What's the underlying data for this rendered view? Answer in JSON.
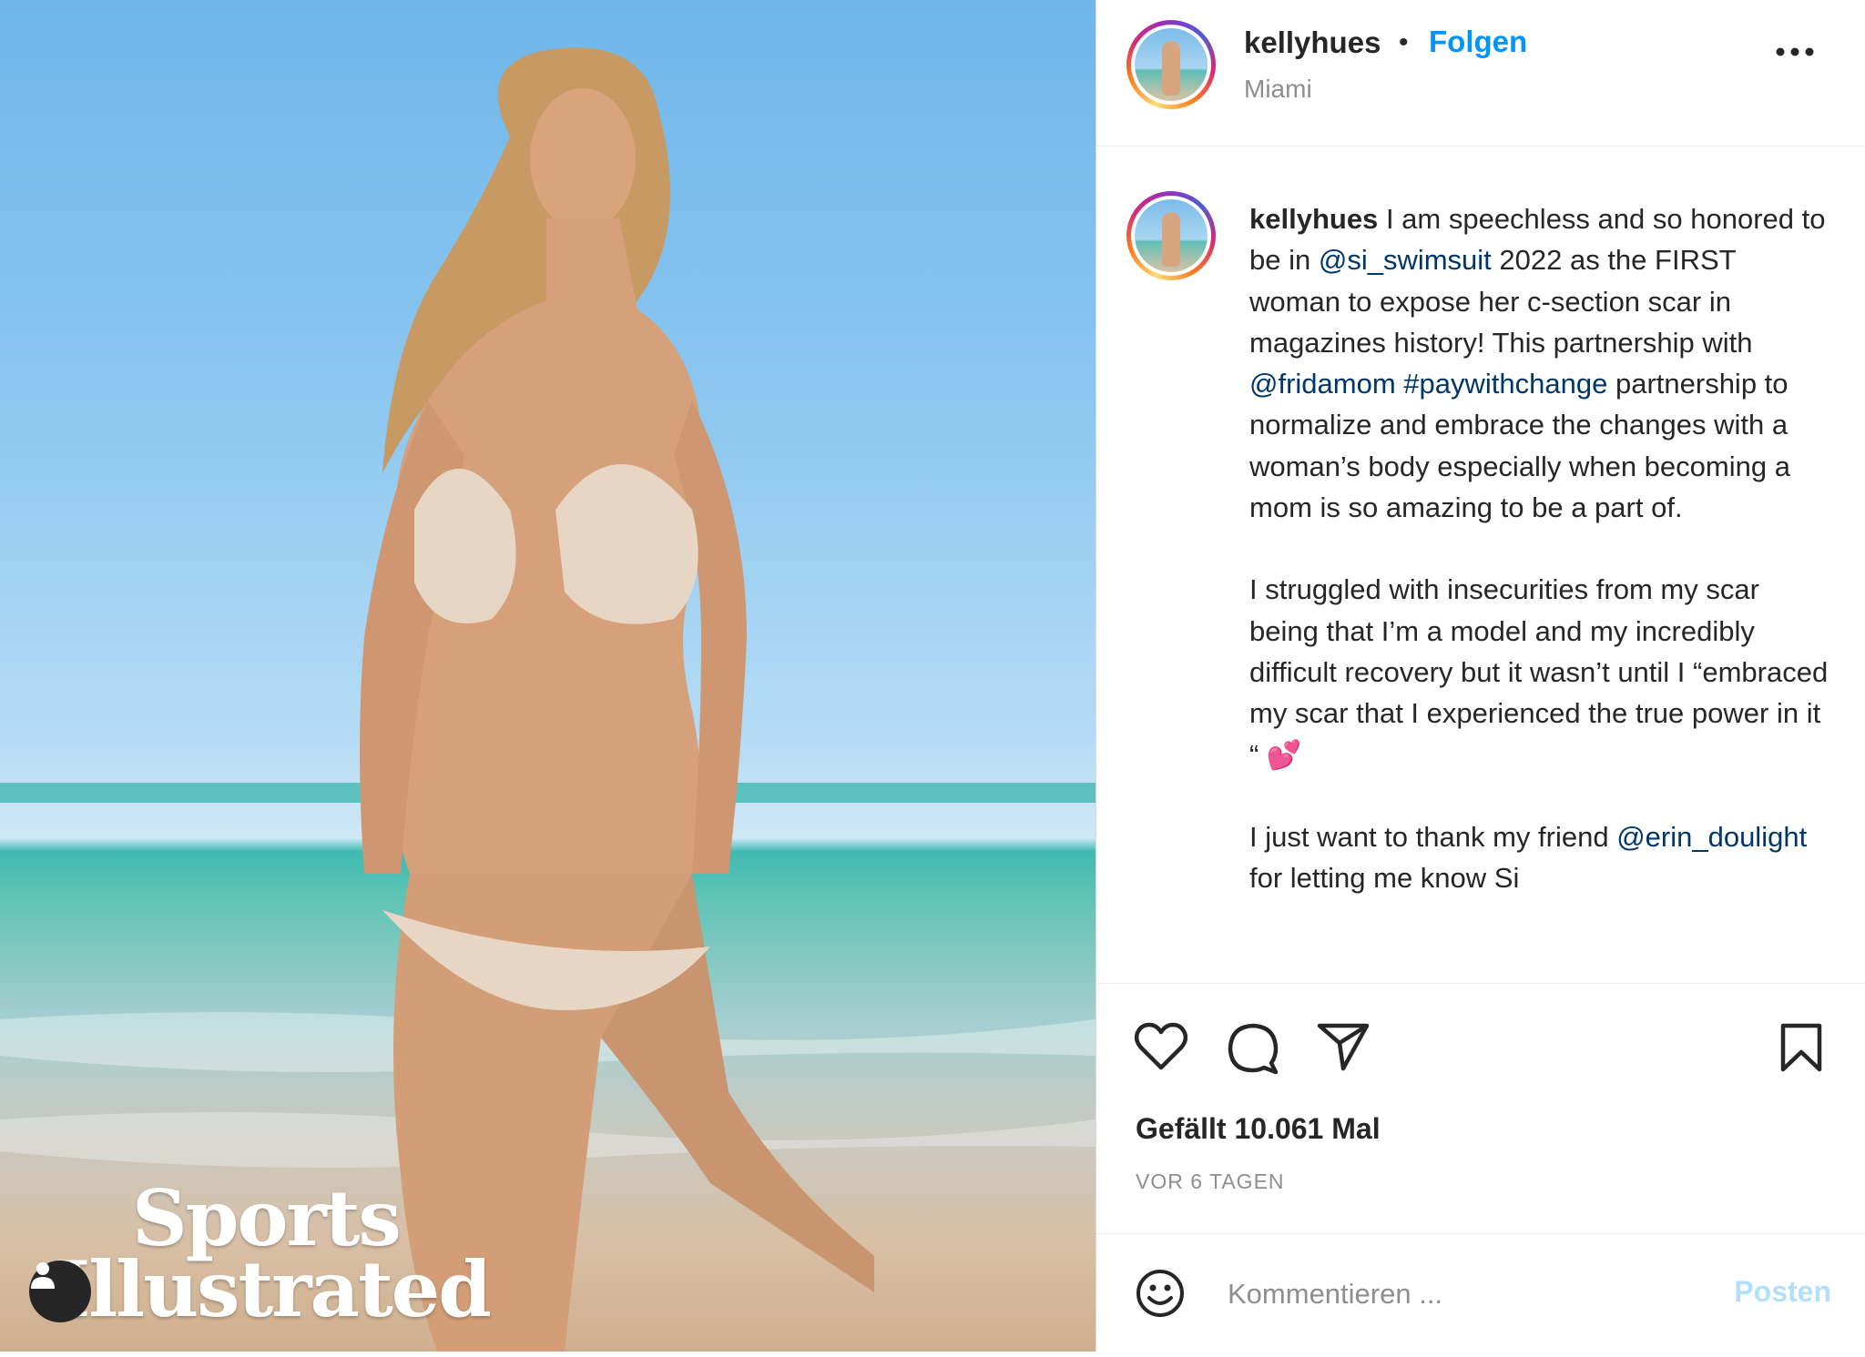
{
  "post": {
    "username": "kellyhues",
    "separator": "•",
    "follow_label": "Folgen",
    "location": "Miami",
    "more_icon": "more-horizontal-icon"
  },
  "photo": {
    "logo_line1": "Sports",
    "logo_line2": "Illustrated",
    "user_tag_icon": "person-icon"
  },
  "caption": {
    "username": "kellyhues",
    "p1": [
      {
        "t": "I am speechless and so honored to be in ",
        "type": "text"
      },
      {
        "t": "@si_swimsuit",
        "type": "mention"
      },
      {
        "t": " 2022 as the FIRST woman to expose her c-section scar in magazines history! This partnership with ",
        "type": "text"
      },
      {
        "t": "@fridamom",
        "type": "mention"
      },
      {
        "t": " ",
        "type": "text"
      },
      {
        "t": "#paywithchange",
        "type": "mention"
      },
      {
        "t": " partnership to normalize and embrace the changes with a woman’s body especially when becoming a mom is so amazing to be a part of.",
        "type": "text"
      }
    ],
    "p2": "I struggled with insecurities from my scar being that I’m a model and my incredibly difficult recovery but it wasn’t until I “embraced my scar that I experienced the true power in it “ 💕",
    "p3_text": "I just want to thank my friend ",
    "p3_mention": "@erin_doulight",
    "p3_rest": " for letting me know Si"
  },
  "actions": {
    "like_icon": "heart-icon",
    "comment_icon": "comment-icon",
    "share_icon": "send-icon",
    "save_icon": "bookmark-icon"
  },
  "likes_text": "Gefällt 10.061 Mal",
  "time_text": "VOR 6 TAGEN",
  "comment": {
    "emoji_icon": "smiley-icon",
    "placeholder": "Kommentieren ...",
    "post_label": "Posten"
  },
  "colors": {
    "accent": "#0095f6",
    "mention": "#00376b",
    "post_disabled": "#b2dffc",
    "text": "#262626",
    "muted": "#8e8e8e"
  }
}
